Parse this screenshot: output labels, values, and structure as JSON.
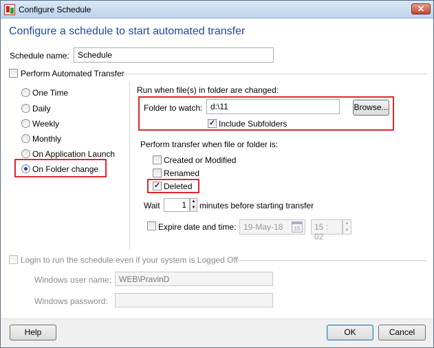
{
  "window": {
    "title": "Configure Schedule",
    "close_icon": "close-icon"
  },
  "heading": "Configure a schedule to start automated transfer",
  "schedule_name": {
    "label": "Schedule name:",
    "value": "Schedule"
  },
  "perform_automated": {
    "label": "Perform Automated Transfer",
    "checked": false
  },
  "schedule_types": [
    {
      "label": "One Time",
      "selected": false
    },
    {
      "label": "Daily",
      "selected": false
    },
    {
      "label": "Weekly",
      "selected": false
    },
    {
      "label": "Monthly",
      "selected": false
    },
    {
      "label": "On Application Launch",
      "selected": false
    },
    {
      "label": "On Folder change",
      "selected": true
    }
  ],
  "folder": {
    "section_label": "Run when file(s) in folder are changed:",
    "label": "Folder to watch:",
    "value": "d:\\11",
    "browse": "Browse...",
    "include_subfolders": "Include Subfolders",
    "include_checked": true
  },
  "transfer_when": {
    "label": "Perform transfer when file or folder is:",
    "options": [
      {
        "label": "Created or Modified",
        "checked": false
      },
      {
        "label": "Renamed",
        "checked": false
      },
      {
        "label": "Deleted",
        "checked": true
      }
    ]
  },
  "wait": {
    "label": "Wait",
    "value": "1",
    "suffix": "minutes before starting transfer"
  },
  "expire": {
    "label": "Expire date and time:",
    "checked": false,
    "date": "19-May-18",
    "calendar_day": "15",
    "time_h": "15",
    "time_m": "02"
  },
  "login": {
    "label": "Login to run the schedule even if your system is Logged Off",
    "checked": false,
    "user_label": "Windows user name:",
    "user_value": "WEB\\PravinD",
    "password_label": "Windows password:",
    "password_value": ""
  },
  "buttons": {
    "help": "Help",
    "ok": "OK",
    "cancel": "Cancel"
  },
  "colors": {
    "heading": "#2146a8",
    "highlight": "#e0262b"
  }
}
